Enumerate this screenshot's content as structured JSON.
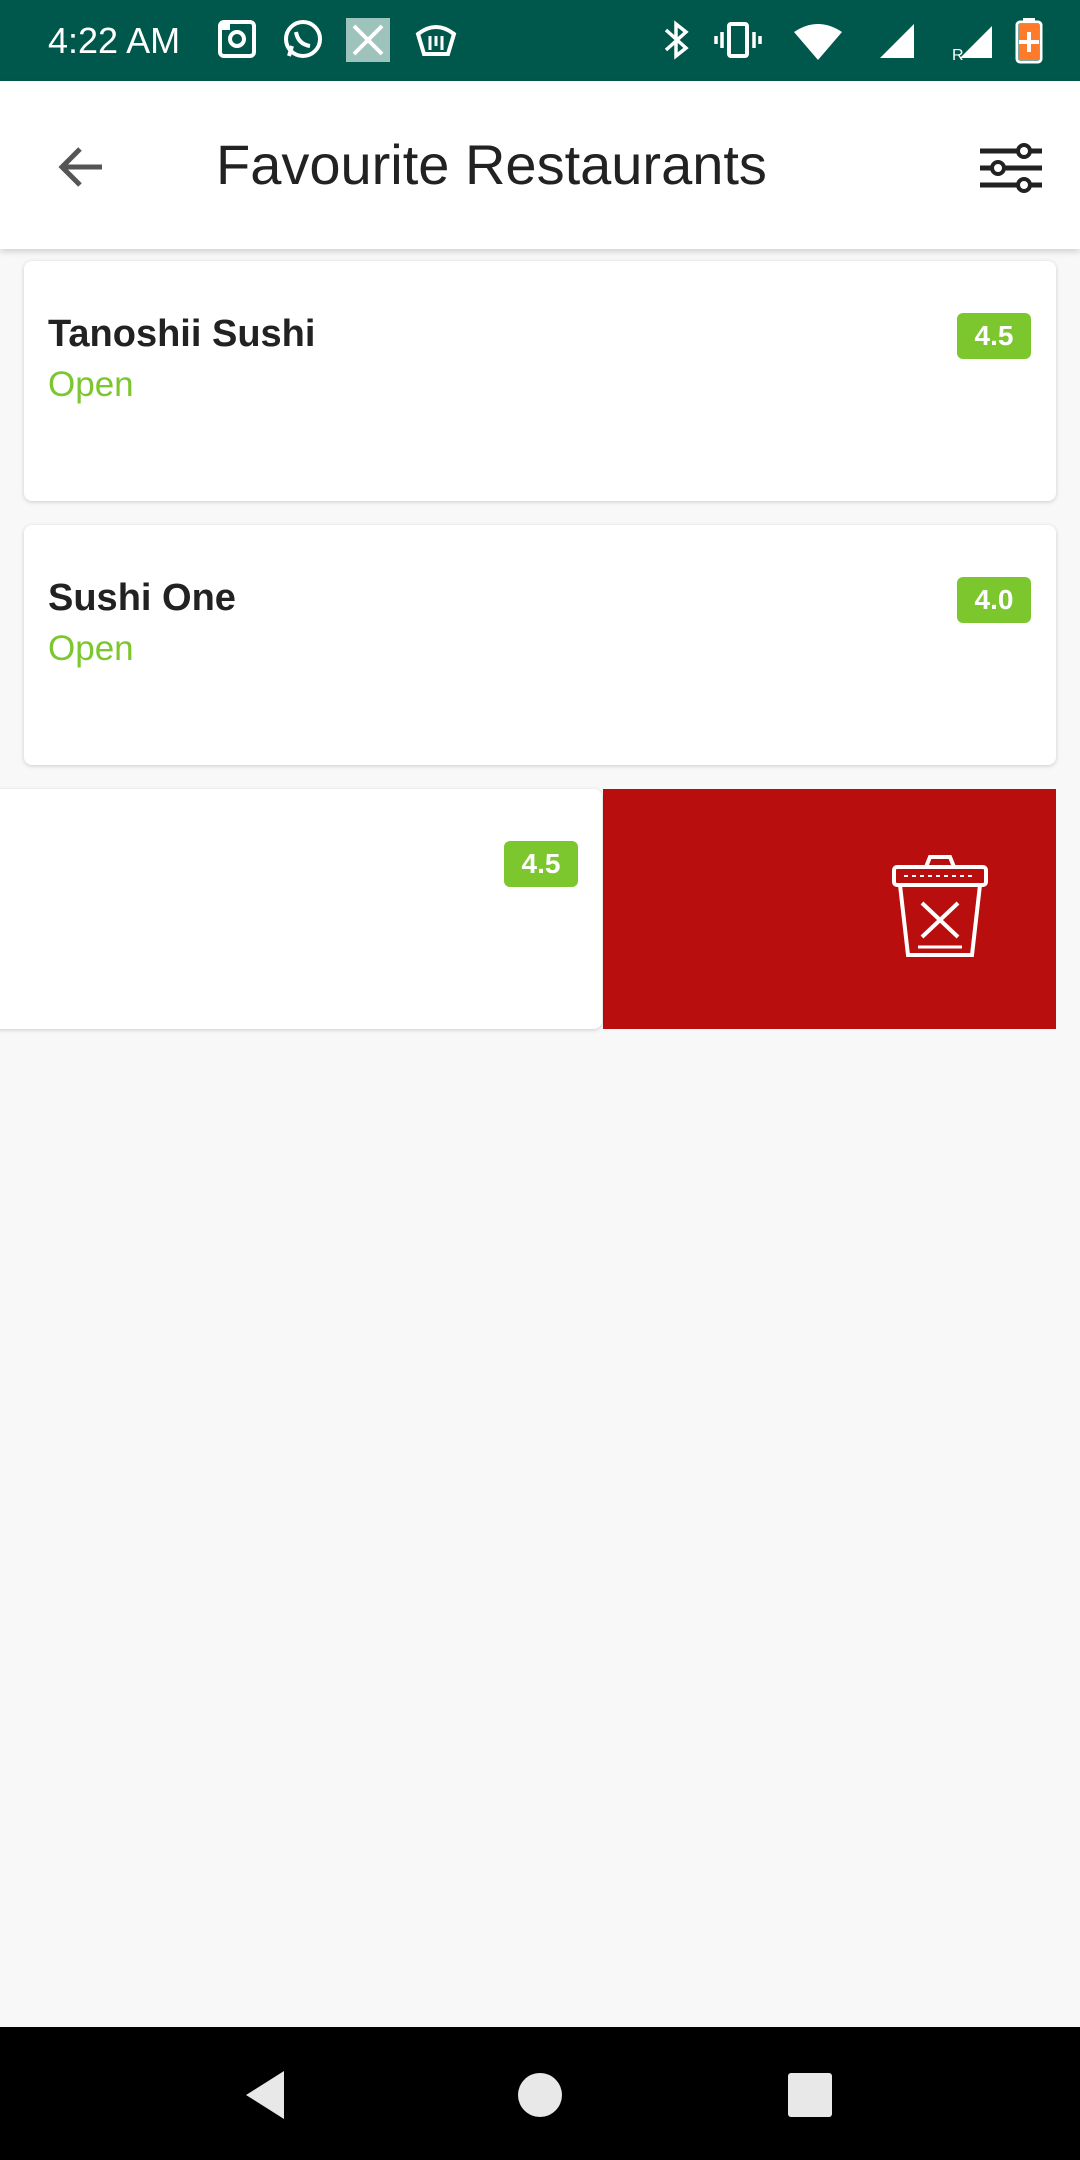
{
  "status_bar": {
    "time": "4:22 AM",
    "icons": [
      "notification-camera-icon",
      "whatsapp-icon",
      "close-app-icon",
      "trexx-icon",
      "bluetooth-icon",
      "vibrate-icon",
      "wifi-icon",
      "signal-icon",
      "signal-roaming-icon",
      "battery-icon"
    ]
  },
  "app_bar": {
    "title": "Favourite Restaurants",
    "back_icon": "arrow-back-icon",
    "filter_icon": "tune-icon"
  },
  "restaurants": [
    {
      "name": "Tanoshii Sushi",
      "status": "Open",
      "rating": "4.5"
    },
    {
      "name": "Sushi One",
      "status": "Open",
      "rating": "4.0"
    },
    {
      "name": "",
      "status": "",
      "rating": "4.5",
      "swiped": true
    }
  ],
  "swipe_action": {
    "icon": "trash-delete-icon"
  },
  "colors": {
    "status_bar": "#00574b",
    "accent_green": "#7cc72e",
    "delete_red": "#b80e0e"
  },
  "nav_bar": {
    "buttons": [
      "back-triangle-icon",
      "home-circle-icon",
      "recents-square-icon"
    ]
  }
}
